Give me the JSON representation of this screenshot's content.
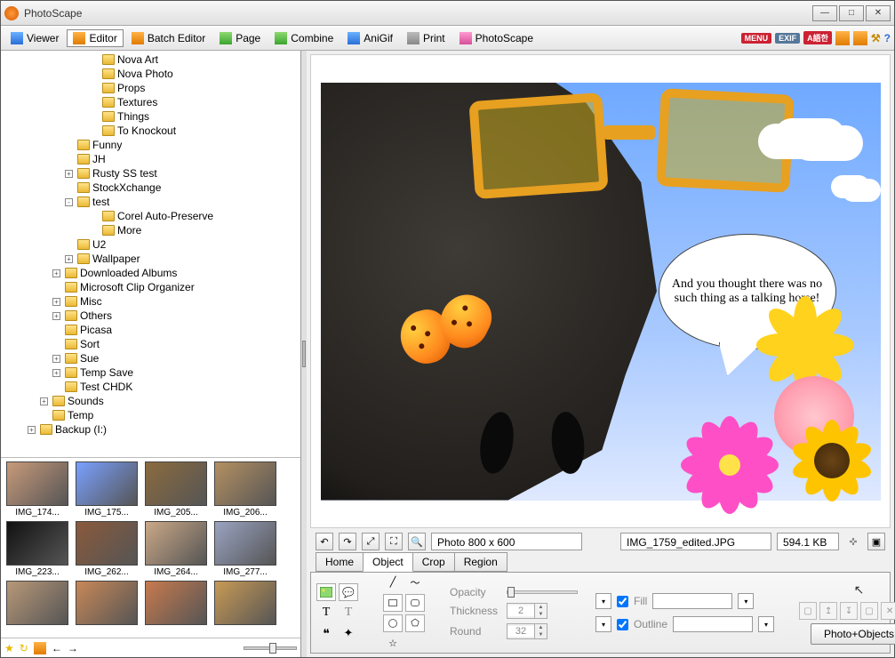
{
  "window": {
    "title": "PhotoScape"
  },
  "toolbar": {
    "tabs": [
      {
        "label": "Viewer"
      },
      {
        "label": "Editor"
      },
      {
        "label": "Batch Editor"
      },
      {
        "label": "Page"
      },
      {
        "label": "Combine"
      },
      {
        "label": "AniGif"
      },
      {
        "label": "Print"
      },
      {
        "label": "PhotoScape"
      }
    ],
    "menu_badge": "MENU",
    "exif_badge": "EXIF",
    "lang_badge": "A語한"
  },
  "tree": {
    "items": [
      {
        "indent": 7,
        "exp": "",
        "label": "Nova Art"
      },
      {
        "indent": 7,
        "exp": "",
        "label": "Nova Photo"
      },
      {
        "indent": 7,
        "exp": "",
        "label": "Props"
      },
      {
        "indent": 7,
        "exp": "",
        "label": "Textures"
      },
      {
        "indent": 7,
        "exp": "",
        "label": "Things"
      },
      {
        "indent": 7,
        "exp": "",
        "label": "To Knockout"
      },
      {
        "indent": 5,
        "exp": "",
        "label": "Funny"
      },
      {
        "indent": 5,
        "exp": "",
        "label": "JH"
      },
      {
        "indent": 5,
        "exp": "+",
        "label": "Rusty SS test"
      },
      {
        "indent": 5,
        "exp": "",
        "label": "StockXchange"
      },
      {
        "indent": 5,
        "exp": "-",
        "label": "test"
      },
      {
        "indent": 7,
        "exp": "",
        "label": "Corel Auto-Preserve"
      },
      {
        "indent": 7,
        "exp": "",
        "label": "More"
      },
      {
        "indent": 5,
        "exp": "",
        "label": "U2"
      },
      {
        "indent": 5,
        "exp": "+",
        "label": "Wallpaper"
      },
      {
        "indent": 4,
        "exp": "+",
        "label": "Downloaded Albums"
      },
      {
        "indent": 4,
        "exp": "",
        "label": "Microsoft Clip Organizer"
      },
      {
        "indent": 4,
        "exp": "+",
        "label": "Misc"
      },
      {
        "indent": 4,
        "exp": "+",
        "label": "Others"
      },
      {
        "indent": 4,
        "exp": "",
        "label": "Picasa"
      },
      {
        "indent": 4,
        "exp": "",
        "label": "Sort"
      },
      {
        "indent": 4,
        "exp": "+",
        "label": "Sue"
      },
      {
        "indent": 4,
        "exp": "+",
        "label": "Temp Save"
      },
      {
        "indent": 4,
        "exp": "",
        "label": "Test CHDK"
      },
      {
        "indent": 3,
        "exp": "+",
        "label": "Sounds"
      },
      {
        "indent": 3,
        "exp": "",
        "label": "Temp"
      },
      {
        "indent": 2,
        "exp": "+",
        "label": "Backup (I:)"
      }
    ]
  },
  "thumbnails": {
    "items": [
      {
        "label": "IMG_174..."
      },
      {
        "label": "IMG_175..."
      },
      {
        "label": "IMG_205..."
      },
      {
        "label": "IMG_206..."
      },
      {
        "label": "IMG_223..."
      },
      {
        "label": "IMG_262..."
      },
      {
        "label": "IMG_264..."
      },
      {
        "label": "IMG_277..."
      },
      {
        "label": ""
      },
      {
        "label": ""
      },
      {
        "label": ""
      },
      {
        "label": ""
      }
    ]
  },
  "canvas": {
    "speech_text": "And you thought there was no such thing as a talking horse!"
  },
  "infobar": {
    "photo_dims": "Photo 800 x 600",
    "filename": "IMG_1759_edited.JPG",
    "filesize": "594.1 KB"
  },
  "editor_tabs": [
    {
      "label": "Home"
    },
    {
      "label": "Object"
    },
    {
      "label": "Crop"
    },
    {
      "label": "Region"
    }
  ],
  "object_panel": {
    "opacity_label": "Opacity",
    "thickness_label": "Thickness",
    "thickness_value": "2",
    "round_label": "Round",
    "round_value": "32",
    "fill_label": "Fill",
    "outline_label": "Outline",
    "photo_objects_btn": "Photo+Objects"
  }
}
